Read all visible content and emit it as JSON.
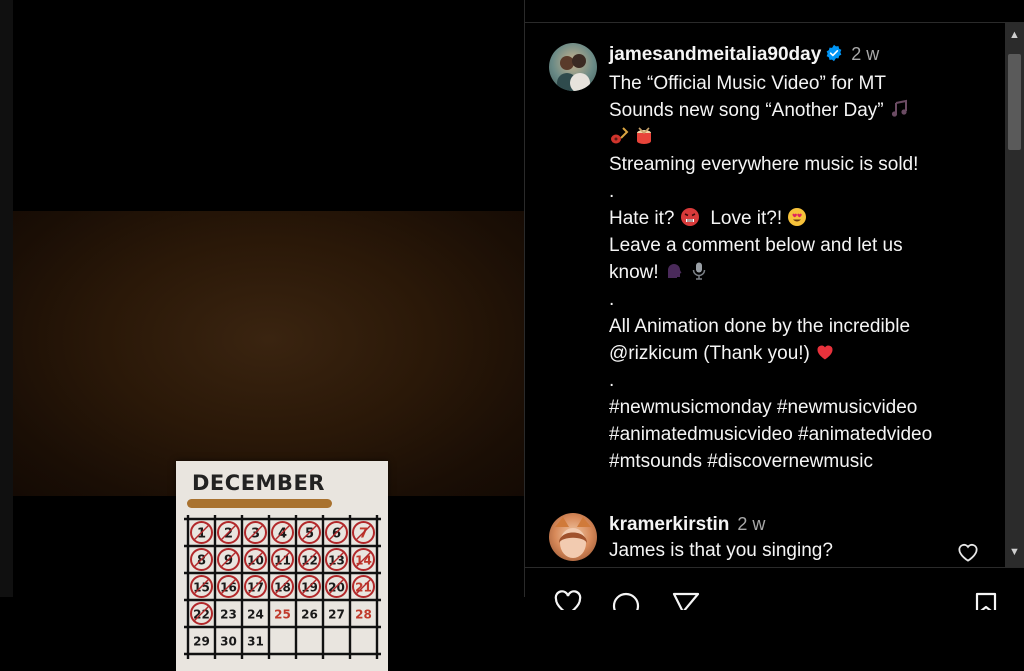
{
  "post": {
    "username": "jamesandmeitalia90day",
    "verified": true,
    "timestamp": "2 w",
    "caption_lines": [
      "The “Official Music Video” for MT",
      "Sounds new song “Another Day”",
      "",
      "Streaming everywhere music is sold!",
      ".",
      "Hate it?",
      "Love it?!",
      "Leave a comment below and let us",
      "know!",
      ".",
      "All Animation done by the incredible",
      "@rizkicum (Thank you!)",
      ".",
      "#newmusicmonday #newmusicvideo",
      "#animatedmusicvideo #animatedvideo",
      "#mtsounds #discovernewmusic"
    ]
  },
  "comment": {
    "username": "kramerkirstin",
    "timestamp": "2 w",
    "text": "James is that you singing?"
  },
  "calendar": {
    "month": "DECEMBER",
    "days": [
      "1",
      "2",
      "3",
      "4",
      "5",
      "6",
      "7",
      "8",
      "9",
      "10",
      "11",
      "12",
      "13",
      "14",
      "15",
      "16",
      "17",
      "18",
      "19",
      "20",
      "21",
      "22",
      "23",
      "24",
      "25",
      "26",
      "27",
      "28",
      "29",
      "30",
      "31"
    ],
    "crossed_through": 22,
    "red_days": [
      7,
      14,
      21,
      25,
      28
    ]
  },
  "icons": {
    "verified": "verified-badge-icon",
    "like": "heart-icon",
    "comment": "comment-icon",
    "share": "share-icon",
    "save": "bookmark-icon"
  },
  "colors": {
    "verified": "#0095f6",
    "heart": "#e8323c",
    "calendar_red": "#c0392b"
  }
}
